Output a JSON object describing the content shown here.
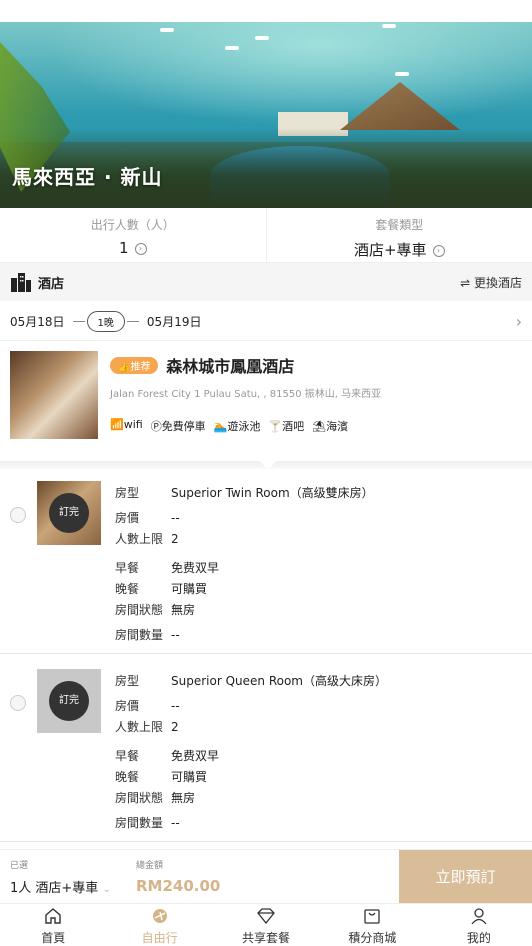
{
  "hero": {
    "title": "馬來西亞 · 新山"
  },
  "options": {
    "travelers": {
      "label": "出行人數（人）",
      "value": "1"
    },
    "package": {
      "label": "套餐類型",
      "value": "酒店+專車"
    }
  },
  "hotel_bar": {
    "label": "酒店",
    "change_label": "⇌ 更換酒店"
  },
  "dates": {
    "checkin": "05月18日",
    "nights": "1晚",
    "checkout": "05月19日"
  },
  "hotel": {
    "badge": "👍推荐",
    "name": "森林城市鳳凰酒店",
    "address": "Jalan Forest City 1 Pulau Satu, , 81550 振林山, 马来西亚",
    "amenities": [
      "wifi",
      "免費停車",
      "遊泳池",
      "酒吧",
      "海濱"
    ]
  },
  "rooms": [
    {
      "sold_label": "訂完",
      "fields": [
        {
          "k": "房型",
          "v": "Superior Twin Room（高级雙床房）"
        },
        {
          "k": "房價",
          "v": "--"
        },
        {
          "k": "人數上限",
          "v": "2"
        },
        {
          "k": "早餐",
          "v": "免费双早"
        },
        {
          "k": "晚餐",
          "v": "可購買"
        },
        {
          "k": "房間狀態",
          "v": "無房"
        },
        {
          "k": "房間數量",
          "v": "--"
        }
      ]
    },
    {
      "sold_label": "訂完",
      "fields": [
        {
          "k": "房型",
          "v": "Superior Queen Room（高级大床房）"
        },
        {
          "k": "房價",
          "v": "--"
        },
        {
          "k": "人數上限",
          "v": "2"
        },
        {
          "k": "早餐",
          "v": "免费双早"
        },
        {
          "k": "晚餐",
          "v": "可購買"
        },
        {
          "k": "房間狀態",
          "v": "無房"
        },
        {
          "k": "房間數量",
          "v": "--"
        }
      ]
    }
  ],
  "bottom": {
    "selected_label": "已選",
    "selected_value": "1人 酒店+專車",
    "total_label": "總金額",
    "total_value": "RM240.00",
    "book_label": "立即預訂"
  },
  "tabs": [
    {
      "label": "首頁",
      "icon": "home-icon"
    },
    {
      "label": "自由行",
      "icon": "travel-icon"
    },
    {
      "label": "共享套餐",
      "icon": "diamond-icon"
    },
    {
      "label": "積分商城",
      "icon": "shop-icon"
    },
    {
      "label": "我的",
      "icon": "user-icon"
    }
  ],
  "colors": {
    "accent": "#d6b48a",
    "book_bg": "#d9bd98",
    "badge": "#f5a64f"
  }
}
